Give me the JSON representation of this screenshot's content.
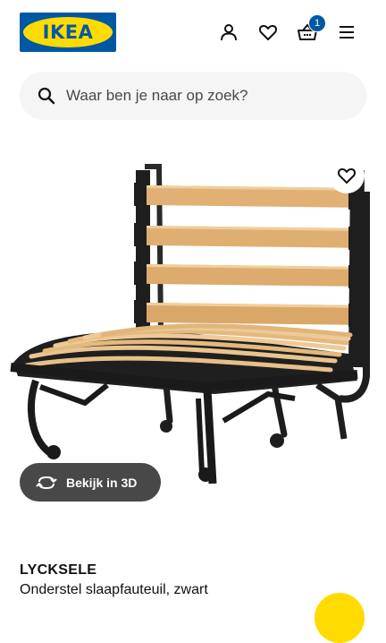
{
  "header": {
    "logo_text": "IKEA",
    "icons": [
      "profile-icon",
      "heart-icon",
      "basket-icon",
      "menu-icon"
    ],
    "cart_count": "1"
  },
  "search": {
    "placeholder": "Waar ben je naar op zoek?"
  },
  "product": {
    "view_3d_label": "Bekijk in 3D",
    "name": "LYCKSELE",
    "description": "Onderstel slaapfauteuil, zwart"
  },
  "colors": {
    "ikea_blue": "#0058a3",
    "ikea_yellow": "#ffdb00",
    "button_dark": "#484848"
  }
}
